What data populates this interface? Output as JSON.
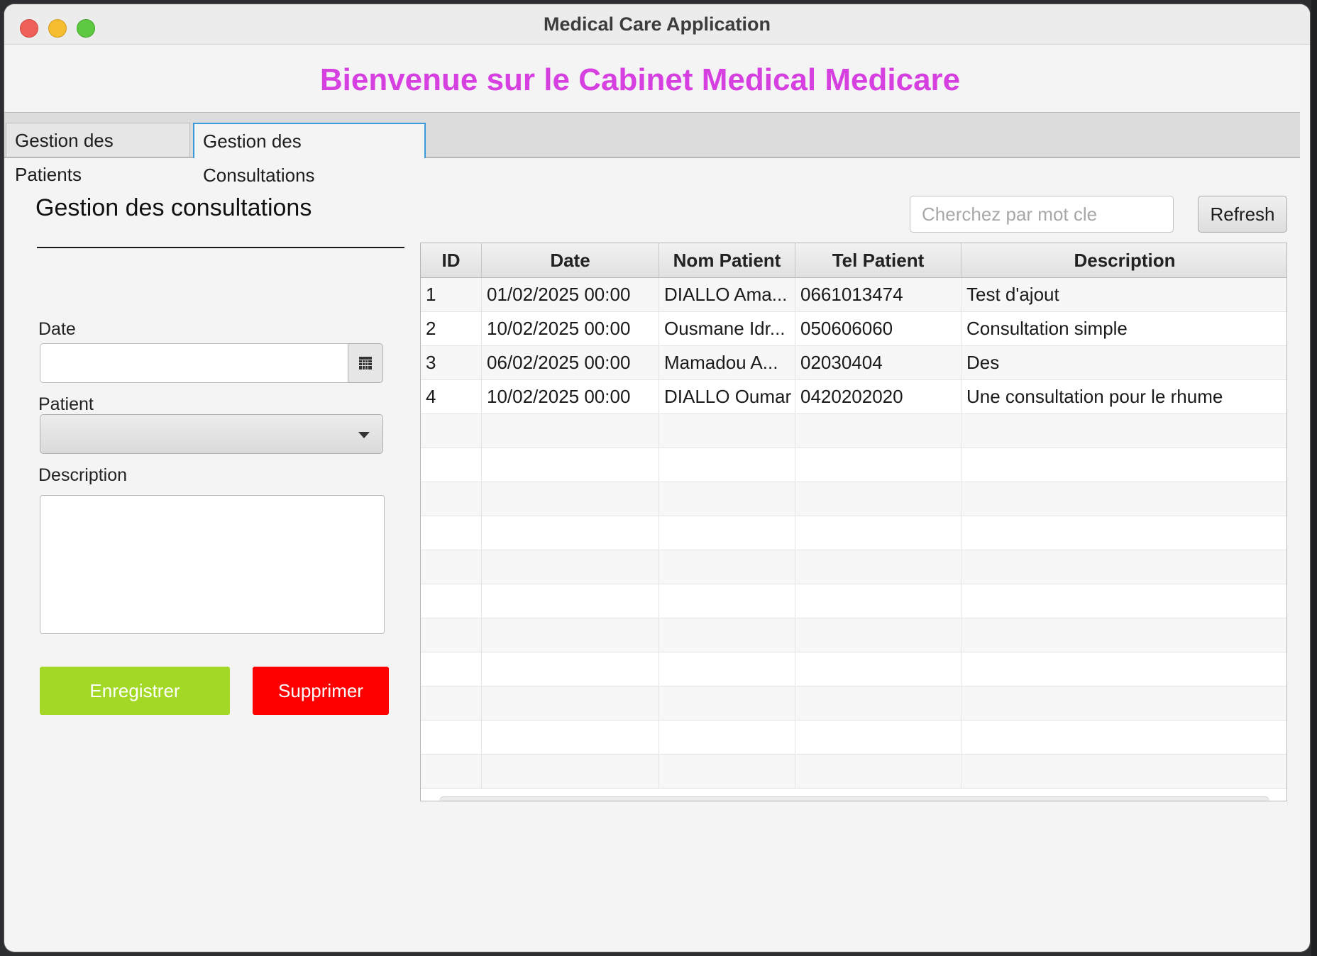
{
  "window": {
    "title": "Medical Care Application"
  },
  "header": {
    "welcome": "Bienvenue sur le Cabinet Medical Medicare"
  },
  "tabs": [
    {
      "label": "Gestion des Patients",
      "selected": false
    },
    {
      "label": "Gestion des Consultations",
      "selected": true
    }
  ],
  "form": {
    "title": "Gestion des consultations",
    "date_label": "Date",
    "date_value": "",
    "patient_label": "Patient",
    "patient_value": "",
    "description_label": "Description",
    "description_value": "",
    "save_label": "Enregistrer",
    "delete_label": "Supprimer"
  },
  "toolbar": {
    "search_placeholder": "Cherchez par mot cle",
    "refresh_label": "Refresh"
  },
  "table": {
    "columns": [
      "ID",
      "Date",
      "Nom Patient",
      "Tel Patient",
      "Description"
    ],
    "rows": [
      [
        "1",
        "01/02/2025 00:00",
        "DIALLO Ama...",
        "0661013474",
        "Test d'ajout"
      ],
      [
        "2",
        "10/02/2025 00:00",
        "Ousmane Idr...",
        "050606060",
        "Consultation simple"
      ],
      [
        "3",
        "06/02/2025 00:00",
        "Mamadou A...",
        "02030404",
        "Des"
      ],
      [
        "4",
        "10/02/2025 00:00",
        "DIALLO Oumar",
        "0420202020",
        "Une consultation pour le rhume"
      ]
    ]
  },
  "colors": {
    "welcome": "#d63fe0",
    "save_button": "#a3d926",
    "delete_button": "#ff0000",
    "tab_focus": "#3b9ad9"
  }
}
